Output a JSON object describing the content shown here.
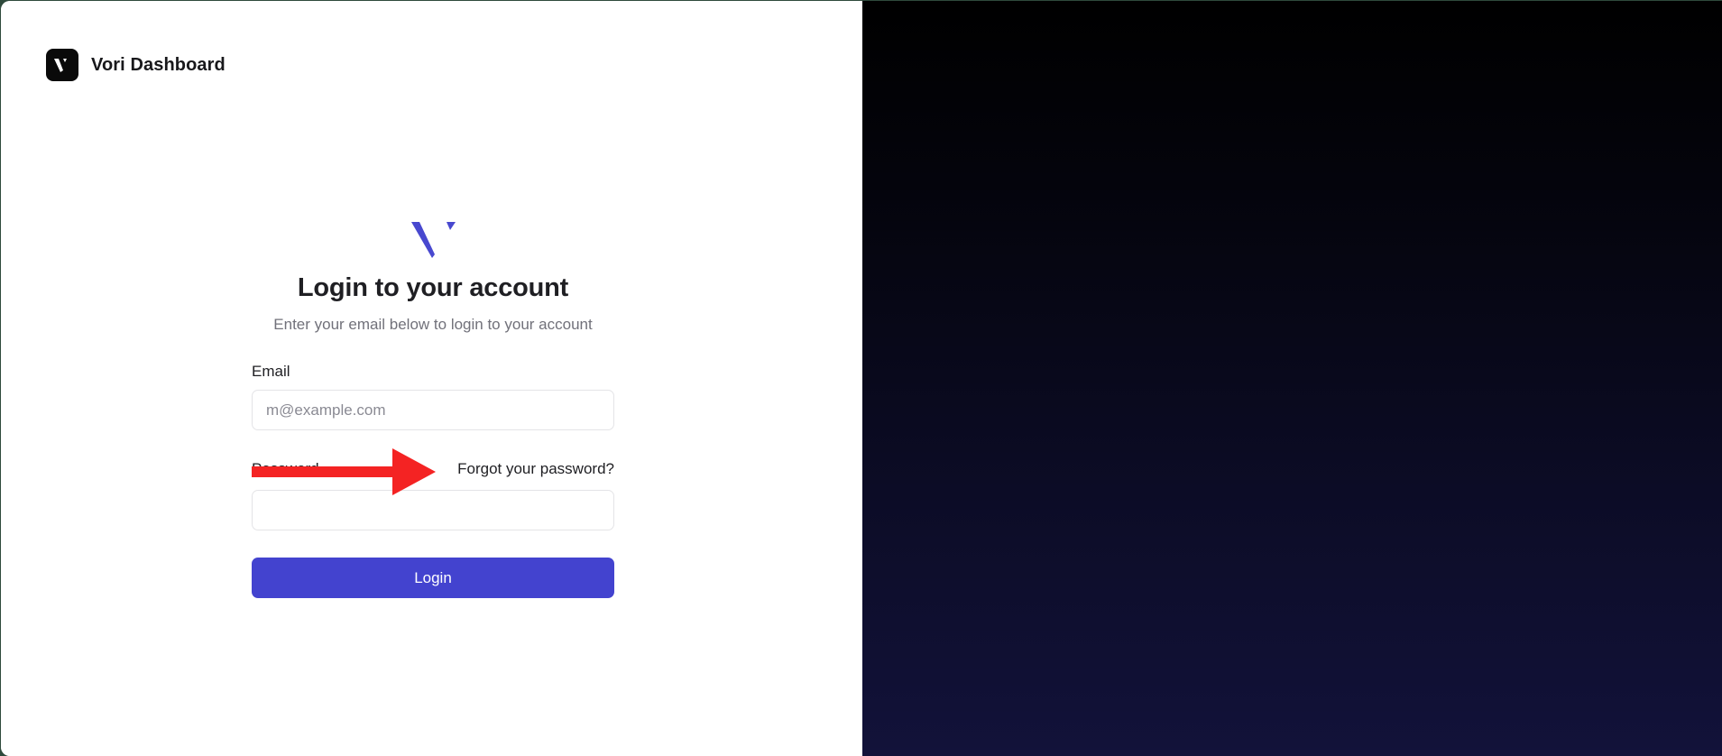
{
  "app": {
    "brand_name": "Vori Dashboard",
    "brand_icon": "vori-logo-icon",
    "accent_color": "#4343cf"
  },
  "login_form": {
    "logo_icon": "vori-v-logo-icon",
    "title": "Login to your account",
    "subtitle": "Enter your email below to login to your account",
    "email_label": "Email",
    "email_value": "",
    "email_placeholder": "m@example.com",
    "password_label": "Password",
    "password_value": "",
    "forgot_password_link": "Forgot your password?",
    "login_button_label": "Login"
  },
  "annotation": {
    "icon": "red-arrow-icon",
    "color": "#f42323"
  }
}
